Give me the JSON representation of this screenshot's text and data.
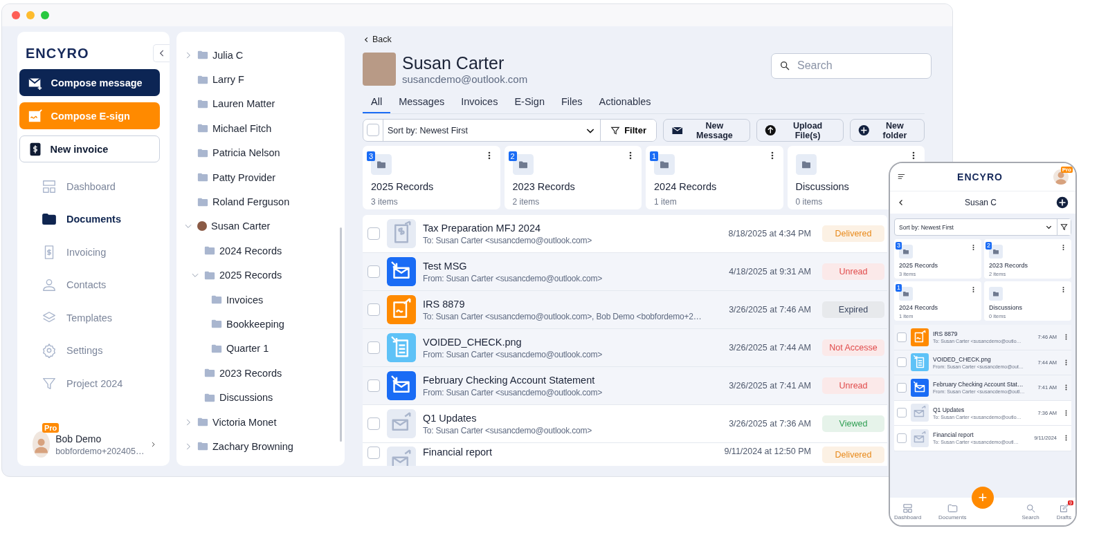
{
  "sidebar": {
    "logo": "ENCYRO",
    "buttons": [
      {
        "label": "Compose message",
        "kind": "primary"
      },
      {
        "label": "Compose E-sign",
        "kind": "accent"
      },
      {
        "label": "New invoice",
        "kind": "outline"
      }
    ],
    "nav": [
      {
        "label": "Dashboard",
        "kind": "dashboard",
        "selected": false
      },
      {
        "label": "Documents",
        "kind": "documents",
        "selected": true
      },
      {
        "label": "Invoicing",
        "kind": "invoicing",
        "selected": false
      },
      {
        "label": "Contacts",
        "kind": "contacts",
        "selected": false
      },
      {
        "label": "Templates",
        "kind": "templates",
        "selected": false
      },
      {
        "label": "Settings",
        "kind": "settings",
        "selected": false
      },
      {
        "label": "Project 2024",
        "kind": "project",
        "selected": false
      }
    ],
    "user": {
      "name": "Bob Demo",
      "email": "bobfordemo+202405…",
      "badge": "Pro"
    }
  },
  "tree": [
    {
      "label": "Julia C",
      "kind": "branch",
      "expanded": false
    },
    {
      "label": "Larry F",
      "kind": "leaf"
    },
    {
      "label": "Lauren Matter",
      "kind": "leaf"
    },
    {
      "label": "Michael Fitch",
      "kind": "leaf"
    },
    {
      "label": "Patricia Nelson",
      "kind": "leaf"
    },
    {
      "label": "Patty Provider",
      "kind": "leaf"
    },
    {
      "label": "Roland Ferguson",
      "kind": "leaf"
    },
    {
      "label": "Susan Carter",
      "kind": "contact",
      "expanded": true,
      "children": [
        {
          "label": "2024 Records",
          "kind": "leaf"
        },
        {
          "label": "2025 Records",
          "kind": "branch",
          "expanded": true,
          "children": [
            {
              "label": "Invoices",
              "kind": "leaf"
            },
            {
              "label": "Bookkeeping",
              "kind": "leaf"
            },
            {
              "label": "Quarter 1",
              "kind": "leaf"
            }
          ]
        },
        {
          "label": "2023 Records",
          "kind": "leaf"
        },
        {
          "label": "Discussions",
          "kind": "leaf"
        }
      ]
    },
    {
      "label": "Victoria Monet",
      "kind": "branch",
      "expanded": false
    },
    {
      "label": "Zachary Browning",
      "kind": "branch",
      "expanded": false
    }
  ],
  "main": {
    "back": "Back",
    "contact": {
      "name": "Susan Carter",
      "email": "susancdemo@outlook.com"
    },
    "search": {
      "placeholder": "Search"
    },
    "tabs": [
      {
        "label": "All",
        "selected": true
      },
      {
        "label": "Messages",
        "selected": false
      },
      {
        "label": "Invoices",
        "selected": false
      },
      {
        "label": "E-Sign",
        "selected": false
      },
      {
        "label": "Files",
        "selected": false
      },
      {
        "label": "Actionables",
        "selected": false
      }
    ],
    "select_all": {
      "checked": false
    },
    "sort": "Sort by: Newest First",
    "filter": "Filter",
    "actions": [
      {
        "label": "New Message",
        "kind": "message"
      },
      {
        "label": "Upload File(s)",
        "kind": "upload"
      },
      {
        "label": "New folder",
        "kind": "folder"
      }
    ],
    "folders": [
      {
        "name": "2025 Records",
        "count": "3 items",
        "badge": "3"
      },
      {
        "name": "2023 Records",
        "count": "2 items",
        "badge": "2"
      },
      {
        "name": "2024 Records",
        "count": "1 item",
        "badge": "1"
      },
      {
        "name": "Discussions",
        "count": "0 items"
      }
    ],
    "rows": [
      {
        "kind": "invoice",
        "title": "Tax Preparation MFJ 2024",
        "subtitle": "To: Susan Carter <susancdemo@outlook.com>",
        "date": "8/18/2025 at 4:34 PM",
        "status": "Delivered",
        "color": "#e8891a",
        "highlighted": false,
        "checked": false
      },
      {
        "kind": "message-in",
        "title": "Test MSG",
        "subtitle": "From: Susan Carter <susancdemo@outlook.com>",
        "date": "4/18/2025 at 9:31 AM",
        "status": "Unread",
        "color": "#e04a4a",
        "highlighted": true,
        "checked": false
      },
      {
        "kind": "esign",
        "title": "IRS 8879",
        "subtitle": "To: Susan Carter <susancdemo@outlook.com>, Bob Demo <bobfordemo+2…",
        "date": "3/26/2025 at 7:46 AM",
        "status": "Expired",
        "color": "#3a4660",
        "highlighted": true,
        "checked": false
      },
      {
        "kind": "file-in",
        "title": "VOIDED_CHECK.png",
        "subtitle": "From: Susan Carter <susancdemo@outlook.com>",
        "date": "3/26/2025 at 7:44 AM",
        "status": "Not Accesse",
        "color": "#e04a4a",
        "highlighted": true,
        "checked": false
      },
      {
        "kind": "message-in",
        "title": "February Checking Account Statement",
        "subtitle": "From: Susan Carter <susancdemo@outlook.com>",
        "date": "3/26/2025 at 7:41 AM",
        "status": "Unread",
        "color": "#e04a4a",
        "highlighted": true,
        "checked": false
      },
      {
        "kind": "message-out",
        "title": "Q1 Updates",
        "subtitle": "To: Susan Carter <susancdemo@outlook.com>",
        "date": "3/26/2025 at 7:36 AM",
        "status": "Viewed",
        "color": "#2e9e52",
        "highlighted": false,
        "checked": false
      },
      {
        "kind": "message-out",
        "title": "Financial report",
        "date": "9/11/2024 at 12:50 PM",
        "status": "Delivered",
        "color": "#e8891a",
        "highlighted": false,
        "checked": false
      }
    ]
  },
  "phone": {
    "logo": "ENCYRO",
    "avatar_badge": "Pro",
    "title": "Susan C",
    "sort": "Sort by: Newest First",
    "folders": [
      {
        "name": "2025 Records",
        "count": "3 items",
        "badge": "3"
      },
      {
        "name": "2023 Records",
        "count": "2 items",
        "badge": "2"
      },
      {
        "name": "2024 Records",
        "count": "1 item",
        "badge": "1"
      },
      {
        "name": "Discussions",
        "count": "0 items"
      }
    ],
    "rows": [
      {
        "kind": "esign",
        "title": "IRS 8879",
        "subtitle": "To: Susan Carter <susancdemo@outlo…",
        "time": "7:46 AM",
        "highlighted": true,
        "checked": false
      },
      {
        "kind": "file-in",
        "title": "VOIDED_CHECK.png",
        "subtitle": "From: Susan Carter <susancdemo@out…",
        "time": "7:44 AM",
        "highlighted": true,
        "checked": false
      },
      {
        "kind": "message-in",
        "title": "February Checking Account Stat…",
        "subtitle": "From: Susan Carter <susancdemo@outl…",
        "time": "7:41 AM",
        "highlighted": true,
        "checked": false
      },
      {
        "kind": "message-out",
        "title": "Q1 Updates",
        "subtitle": "To: Susan Carter <susancdemo@outlo…",
        "time": "7:36 AM",
        "highlighted": false,
        "checked": false
      },
      {
        "kind": "message-out",
        "title": "Financial report",
        "subtitle": "To: Susan Carter <susancdemo@outl…",
        "time": "9/11/2024",
        "highlighted": false,
        "checked": false
      }
    ],
    "fab": "+",
    "nav": [
      {
        "label": "Dashboard",
        "kind": "dashboard"
      },
      {
        "label": "Documents",
        "kind": "documents"
      },
      {
        "label": "Search",
        "kind": "search"
      },
      {
        "label": "Drafts",
        "kind": "drafts",
        "badge": "9"
      }
    ]
  }
}
